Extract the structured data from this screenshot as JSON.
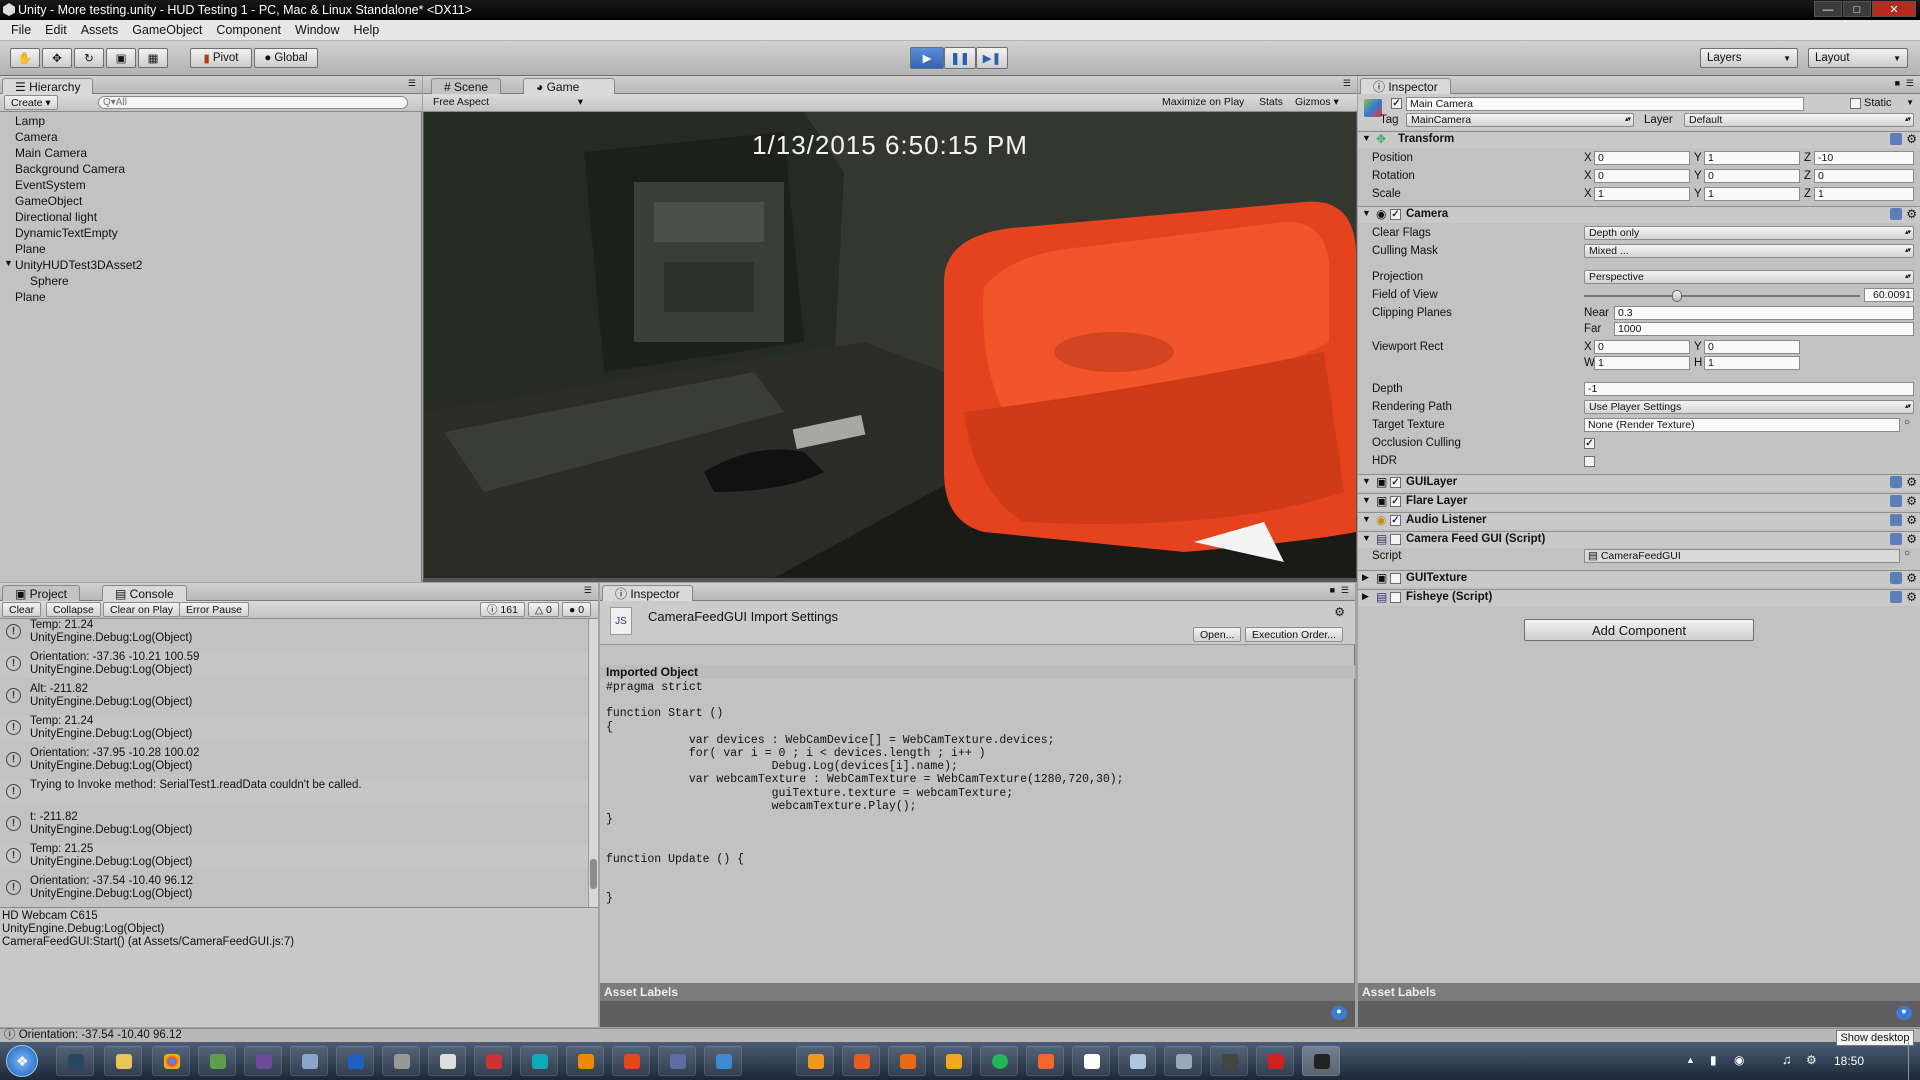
{
  "window": {
    "title": "Unity - More testing.unity - HUD Testing 1 - PC, Mac & Linux Standalone* <DX11>"
  },
  "menu": [
    "File",
    "Edit",
    "Assets",
    "GameObject",
    "Component",
    "Window",
    "Help"
  ],
  "toolbar": {
    "pivot": "Pivot",
    "global": "Global",
    "layers": "Layers",
    "layout": "Layout"
  },
  "hierarchy": {
    "tab": "Hierarchy",
    "create": "Create",
    "search_placeholder": "Q▾All",
    "items": [
      "Lamp",
      "Camera",
      "Main Camera",
      "Background Camera",
      "EventSystem",
      "GameObject",
      "Directional light",
      "DynamicTextEmpty",
      "Plane",
      "UnityHUDTest3DAsset2",
      "Sphere",
      "Plane"
    ]
  },
  "scene_tabs": {
    "scene": "Scene",
    "game": "Game",
    "aspect": "Free Aspect",
    "maximize": "Maximize on Play",
    "stats": "Stats",
    "gizmos": "Gizmos"
  },
  "game_view": {
    "timestamp": "1/13/2015  6:50:15 PM"
  },
  "console": {
    "project_tab": "Project",
    "console_tab": "Console",
    "buttons": {
      "clear": "Clear",
      "collapse": "Collapse",
      "clear_on_play": "Clear on Play",
      "error_pause": "Error Pause"
    },
    "counts": {
      "logs": "161",
      "warnings": "0",
      "errors": "0"
    },
    "rows": [
      {
        "l1": "Temp: 21.24",
        "l2": "UnityEngine.Debug:Log(Object)"
      },
      {
        "l1": "Orientation: -37.36 -10.21 100.59",
        "l2": "UnityEngine.Debug:Log(Object)"
      },
      {
        "l1": "Alt: -211.82",
        "l2": "UnityEngine.Debug:Log(Object)"
      },
      {
        "l1": "Temp: 21.24",
        "l2": "UnityEngine.Debug:Log(Object)"
      },
      {
        "l1": "Orientation: -37.95 -10.28 100.02",
        "l2": "UnityEngine.Debug:Log(Object)"
      },
      {
        "l1": "Trying to Invoke method: SerialTest1.readData couldn't be called.",
        "l2": ""
      },
      {
        "l1": "t: -211.82",
        "l2": "UnityEngine.Debug:Log(Object)"
      },
      {
        "l1": "Temp: 21.25",
        "l2": "UnityEngine.Debug:Log(Object)"
      },
      {
        "l1": "Orientation: -37.54 -10.40 96.12",
        "l2": "UnityEngine.Debug:Log(Object)"
      }
    ],
    "detail": [
      "HD Webcam C615",
      "UnityEngine.Debug:Log(Object)",
      "CameraFeedGUI:Start() (at Assets/CameraFeedGUI.js:7)"
    ],
    "status": "Orientation: -37.54 -10.40 96.12"
  },
  "import_inspector": {
    "tab": "Inspector",
    "title": "CameraFeedGUI Import Settings",
    "open": "Open...",
    "exec_order": "Execution Order...",
    "imported_object": "Imported Object",
    "code": "#pragma strict\n\nfunction Start ()\n{\n            var devices : WebCamDevice[] = WebCamTexture.devices;\n            for( var i = 0 ; i < devices.length ; i++ )\n                        Debug.Log(devices[i].name);\n            var webcamTexture : WebCamTexture = WebCamTexture(1280,720,30);\n                        guiTexture.texture = webcamTexture;\n                        webcamTexture.Play();\n}\n\n\nfunction Update () {\n\n\n}",
    "asset_labels": "Asset Labels"
  },
  "inspector": {
    "tab": "Inspector",
    "object_name": "Main Camera",
    "static": "Static",
    "tag_label": "Tag",
    "tag": "MainCamera",
    "layer_label": "Layer",
    "layer": "Default",
    "transform": {
      "title": "Transform",
      "position": "Position",
      "rotation": "Rotation",
      "scale": "Scale",
      "pos": [
        "0",
        "1",
        "-10"
      ],
      "rot": [
        "0",
        "0",
        "0"
      ],
      "scl": [
        "1",
        "1",
        "1"
      ]
    },
    "axis": {
      "x": "X",
      "y": "Y",
      "z": "Z",
      "w": "W",
      "h": "H"
    },
    "camera": {
      "title": "Camera",
      "clear_flags_label": "Clear Flags",
      "clear_flags": "Depth only",
      "culling_mask_label": "Culling Mask",
      "culling_mask": "Mixed ...",
      "projection_label": "Projection",
      "projection": "Perspective",
      "fov_label": "Field of View",
      "fov": "60.0091",
      "fov_fraction": 0.33,
      "clipping_label": "Clipping Planes",
      "near_label": "Near",
      "near": "0.3",
      "far_label": "Far",
      "far": "1000",
      "viewport_label": "Viewport Rect",
      "vx": "0",
      "vy": "0",
      "vw": "1",
      "vh": "1",
      "depth_label": "Depth",
      "depth": "-1",
      "rendering_path_label": "Rendering Path",
      "rendering_path": "Use Player Settings",
      "target_texture_label": "Target Texture",
      "target_texture": "None (Render Texture)",
      "occlusion_label": "Occlusion Culling",
      "occlusion": true,
      "hdr_label": "HDR",
      "hdr": false
    },
    "components": [
      "GUILayer",
      "Flare Layer",
      "Audio Listener",
      "Camera Feed GUI (Script)",
      "GUITexture",
      "Fisheye (Script)"
    ],
    "script_label": "Script",
    "script": "CameraFeedGUI",
    "add_component": "Add Component",
    "asset_labels": "Asset Labels"
  },
  "taskbar": {
    "show_desktop": "Show desktop",
    "time": "18:50"
  }
}
